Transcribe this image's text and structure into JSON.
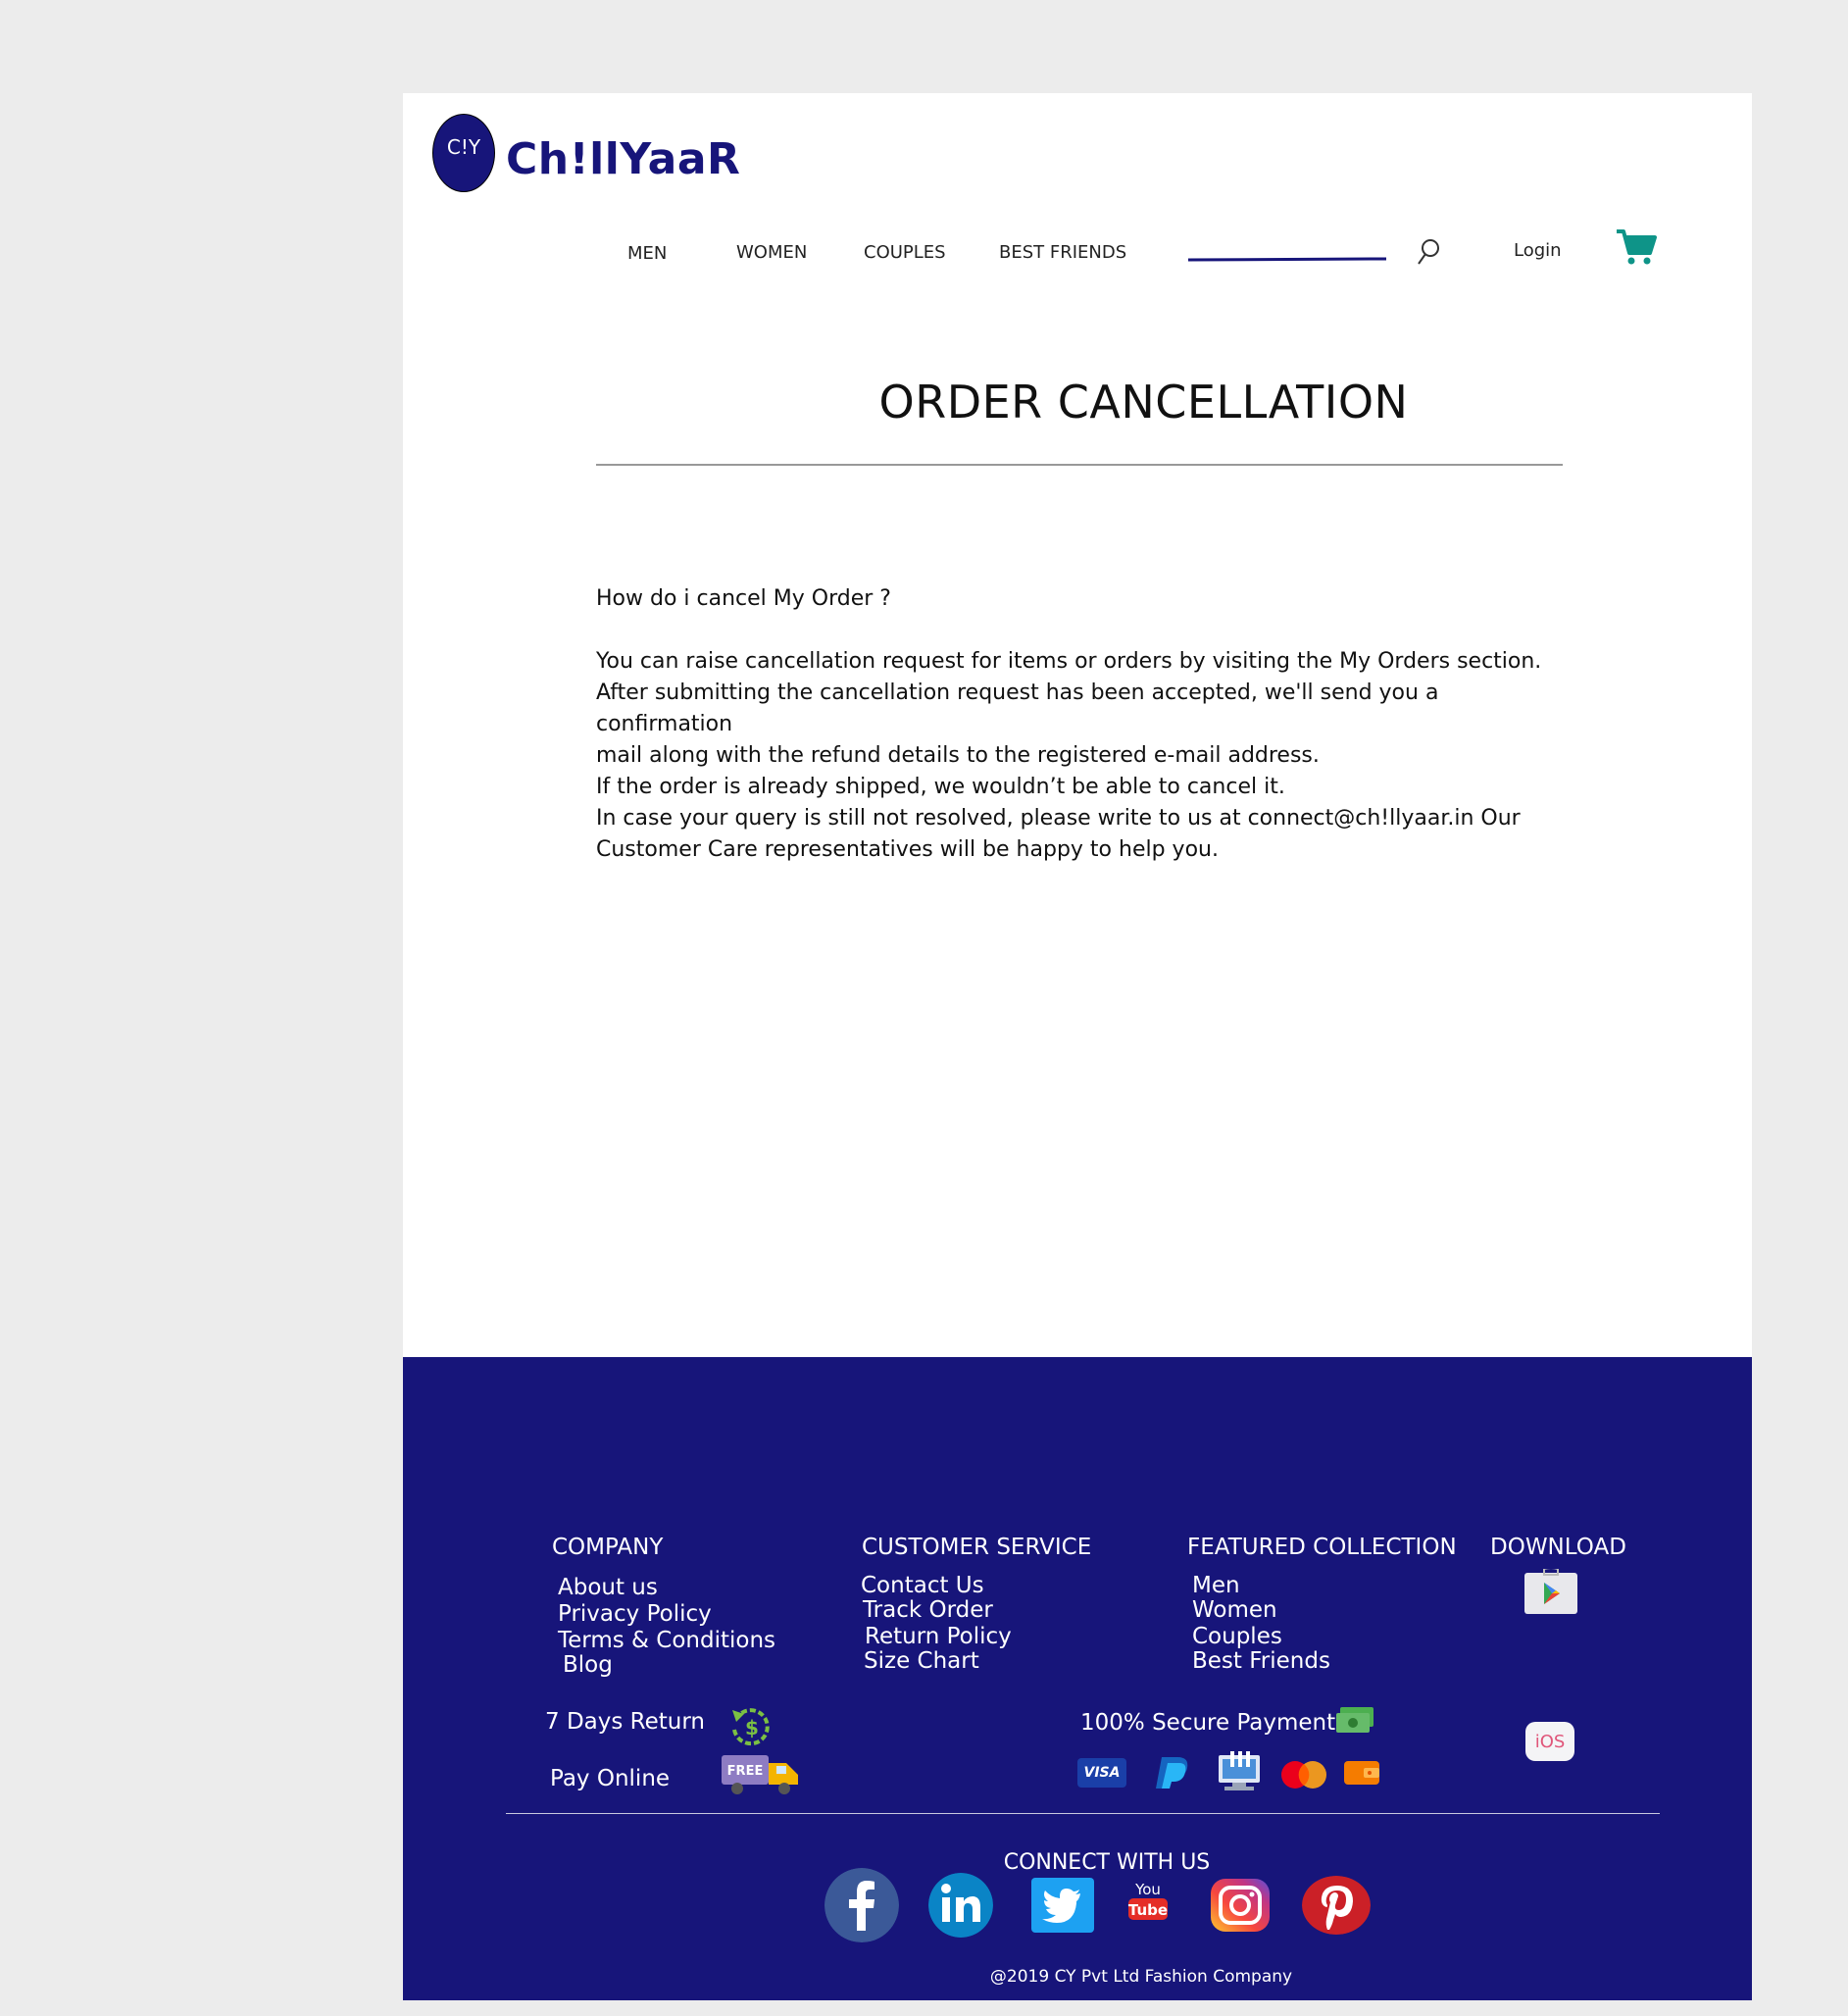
{
  "brand": {
    "logo_mark": "C!Y",
    "name": "Ch!llYaaR"
  },
  "nav": {
    "men": "MEN",
    "women": "WOMEN",
    "couples": "COUPLES",
    "best_friends": "BEST FRIENDS",
    "login": "Login"
  },
  "page": {
    "title": "ORDER CANCELLATION",
    "question": "How do i cancel My Order ?",
    "paragraphs": [
      "You can raise cancellation request for items or orders by visiting the My Orders section.",
      "After submitting the cancellation request has been accepted, we'll send you a confirmation",
      "mail along with the refund details to the registered e-mail address.",
      "If the order is already shipped, we wouldn’t be able to cancel it.",
      "In case your query is still not resolved, please write to us at connect@ch!llyaar.in Our",
      "Customer Care representatives will be happy to help you."
    ]
  },
  "footer": {
    "company": {
      "heading": "COMPANY",
      "links": [
        "About us",
        "Privacy Policy",
        "Terms & Conditions",
        "Blog"
      ]
    },
    "customer_service": {
      "heading": "CUSTOMER SERVICE",
      "links": [
        "Contact Us",
        "Track Order",
        "Return Policy",
        "Size Chart"
      ]
    },
    "featured": {
      "heading": "FEATURED COLLECTION",
      "links": [
        "Men",
        "Women",
        "Couples",
        "Best Friends"
      ]
    },
    "download": {
      "heading": "DOWNLOAD",
      "ios_label": "iOS"
    },
    "returns": "7  Days Return",
    "pay_online": "Pay Online",
    "free_label": "FREE",
    "secure_payment": "100% Secure Payment",
    "visa_label": "VISA",
    "connect": "CONNECT WITH US",
    "youtube_top": "You",
    "youtube_bottom": "Tube",
    "copyright": "@2019 CY Pvt Ltd Fashion Company"
  },
  "colors": {
    "brand": "#17157a",
    "cart": "#0e9488",
    "footer_bg": "#17157a"
  }
}
